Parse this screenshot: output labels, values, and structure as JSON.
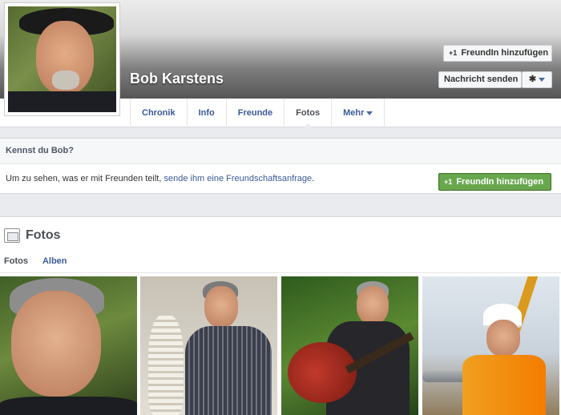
{
  "profile": {
    "name": "Bob Karstens"
  },
  "header_actions": {
    "add_friend_label": "FreundIn hinzufügen",
    "message_label": "Nachricht senden",
    "plus_glyph": "+1"
  },
  "tabs": [
    {
      "label": "Chronik"
    },
    {
      "label": "Info"
    },
    {
      "label": "Freunde"
    },
    {
      "label": "Fotos"
    },
    {
      "label": "Mehr"
    }
  ],
  "know_box": {
    "heading": "Kennst du Bob?",
    "text_prefix": "Um zu sehen, was er mit Freunden teilt, ",
    "link_text": "sende ihm eine Freundschaftsanfrage",
    "text_suffix": ".",
    "button_label": "FreundIn hinzufügen"
  },
  "photos_section": {
    "title": "Fotos",
    "subtabs": [
      {
        "label": "Fotos"
      },
      {
        "label": "Alben"
      }
    ]
  },
  "colors": {
    "link": "#3b5998",
    "green_button": "#69a74e"
  },
  "icons": {
    "gear": "gear-icon",
    "photos": "photos-icon",
    "add_friend": "add-friend-icon"
  }
}
